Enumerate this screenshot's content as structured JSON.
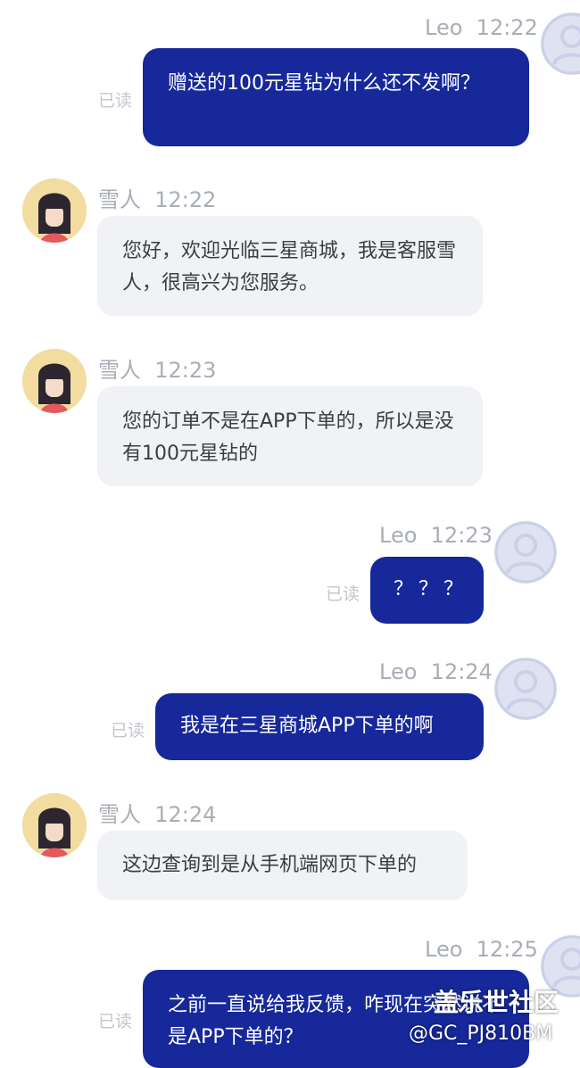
{
  "user_name": "Leo",
  "agent_name": "雪人",
  "read_label": "已读",
  "messages": [
    {
      "from": "user",
      "time": "12:22",
      "text": "赠送的100元星钻为什么还不发啊？"
    },
    {
      "from": "agent",
      "time": "12:22",
      "text": "您好，欢迎光临三星商城，我是客服雪人，很高兴为您服务。"
    },
    {
      "from": "agent",
      "time": "12:23",
      "text": "您的订单不是在APP下单的，所以是没有100元星钻的"
    },
    {
      "from": "user",
      "time": "12:23",
      "text": "？？？"
    },
    {
      "from": "user",
      "time": "12:24",
      "text": "我是在三星商城APP下单的啊"
    },
    {
      "from": "agent",
      "time": "12:24",
      "text": "这边查询到是从手机端网页下单的"
    },
    {
      "from": "user",
      "time": "12:25",
      "text": "之前一直说给我反馈，咋现在突然说不是APP下单的？"
    }
  ],
  "watermark": {
    "brand": "盖乐世社区",
    "handle": "@GC_PJ810BM"
  },
  "colors": {
    "user_bubble": "#16289a",
    "agent_bubble": "#f1f2f5",
    "meta": "#a9aeb6"
  }
}
